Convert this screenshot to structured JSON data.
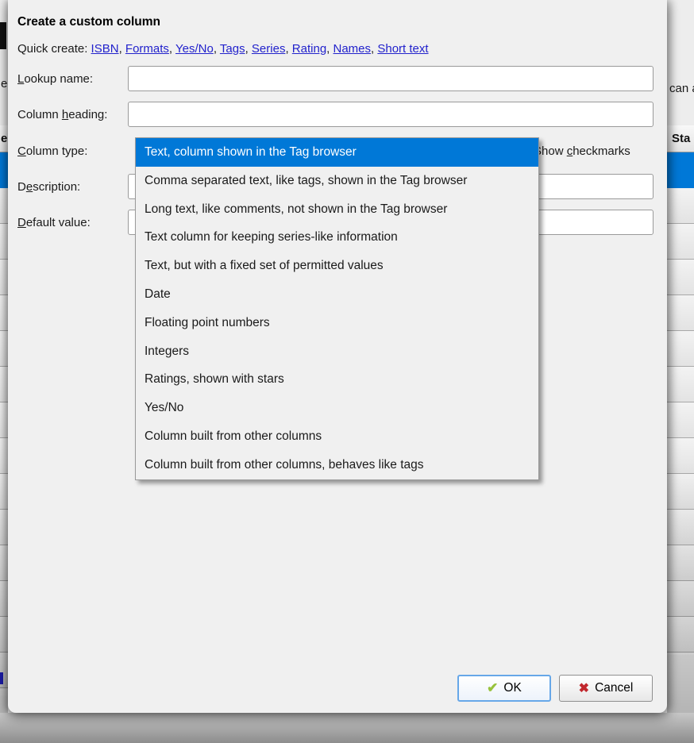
{
  "dialog": {
    "title": "Create a custom column",
    "quick_create": {
      "label": "Quick create:",
      "links": [
        "ISBN",
        "Formats",
        "Yes/No",
        "Tags",
        "Series",
        "Rating",
        "Names",
        "Short text"
      ],
      "separator": ", "
    },
    "fields": {
      "lookup_name": {
        "pre": "",
        "accel": "L",
        "post": "ookup name:",
        "value": "",
        "placeholder": ""
      },
      "column_heading": {
        "pre": "Column ",
        "accel": "h",
        "post": "eading:",
        "value": "",
        "placeholder": ""
      },
      "column_type": {
        "pre": "",
        "accel": "C",
        "post": "olumn type:"
      },
      "description": {
        "pre": "D",
        "accel": "e",
        "post": "scription:",
        "value": "",
        "placeholder": ""
      },
      "default_value": {
        "pre": "",
        "accel": "D",
        "post": "efault value:",
        "value": "",
        "placeholder": ""
      }
    },
    "show_checkmarks": {
      "pre": "Show ",
      "accel": "c",
      "post": "heckmarks"
    },
    "column_type_dropdown": {
      "selected_index": 0,
      "items": [
        "Text, column shown in the Tag browser",
        "Comma separated text, like tags, shown in the Tag browser",
        "Long text, like comments, not shown in the Tag browser",
        "Text column for keeping series-like information",
        "Text, but with a fixed set of permitted values",
        "Date",
        "Floating point numbers",
        "Integers",
        "Ratings, shown with stars",
        "Yes/No",
        "Column built from other columns",
        "Column built from other columns, behaves like tags"
      ]
    },
    "buttons": {
      "ok": {
        "label": "OK",
        "icon": "check-icon",
        "icon_glyph": "✔"
      },
      "cancel": {
        "label": "Cancel",
        "icon": "cross-icon",
        "icon_glyph": "✖"
      }
    }
  },
  "background_window": {
    "right_text_fragment": "can a",
    "right_column_header_fragment": "Sta",
    "left_label_fragment": "e",
    "left_column_header_fragment": "e"
  },
  "colors": {
    "selection_blue": "#0078d7",
    "link_blue": "#2222cc",
    "ok_check_green": "#97c23c",
    "cancel_cross_red": "#c1272d"
  }
}
